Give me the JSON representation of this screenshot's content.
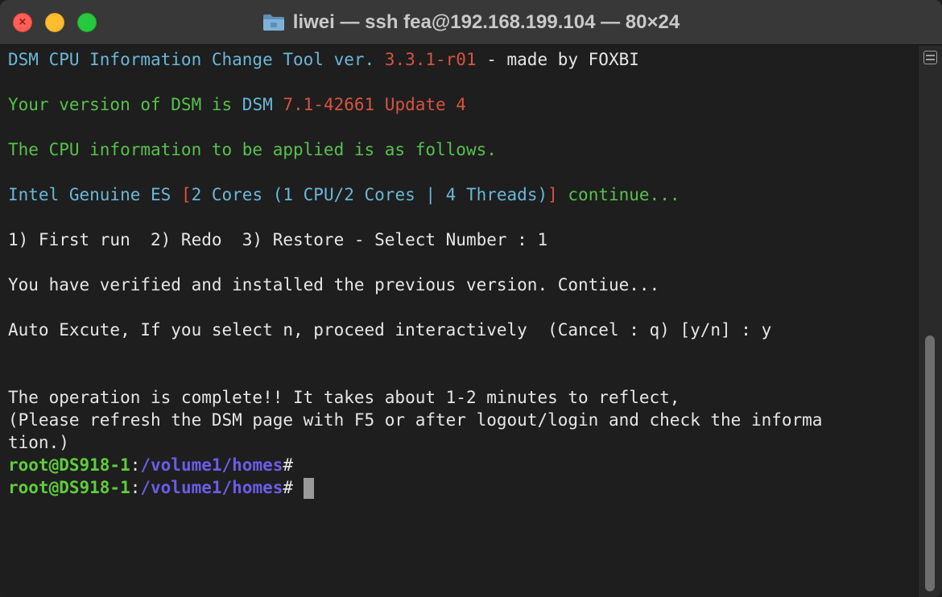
{
  "window": {
    "title": "liwei — ssh fea@192.168.199.104 — 80×24",
    "close_glyph": "×"
  },
  "terminal": {
    "line1": {
      "a": "DSM CPU Information Change Tool ver. ",
      "b": "3.3.1-r01",
      "c": " - made by FOXBI"
    },
    "line2": {
      "a": "Your version of DSM is ",
      "b": "DSM",
      "c": " 7.1-42661 Update 4"
    },
    "line3": "The CPU information to be applied is as follows.",
    "line4": {
      "a": "Intel Genuine ES ",
      "b": "[",
      "c": "2 Cores (1 CPU/2 Cores | 4 Threads)",
      "d": "]",
      "e": " continue..."
    },
    "line5": "1) First run  2) Redo  3) Restore - Select Number : 1",
    "line6": "You have verified and installed the previous version. Contiue...",
    "line7": "Auto Excute, If you select n, proceed interactively  (Cancel : q) [y/n] : y",
    "line8": "The operation is complete!! It takes about 1-2 minutes to reflect,",
    "line9": "(Please refresh the DSM page with F5 or after logout/login and check the informa",
    "line10": "tion.)",
    "prompt1": {
      "user": "root@DS918-1",
      "sep": ":",
      "path": "/volume1/homes",
      "symbol": "#"
    },
    "prompt2": {
      "user": "root@DS918-1",
      "sep": ":",
      "path": "/volume1/homes",
      "symbol": "# "
    }
  },
  "scrollbar": {
    "thumb_fraction_start": 0.53,
    "thumb_fraction_length": 0.46
  },
  "colors": {
    "cyan": "#69b8d8",
    "red": "#d9533f",
    "green": "#56c24b",
    "prompt_green": "#5fcc3c",
    "path_purple": "#6b5ce8"
  }
}
